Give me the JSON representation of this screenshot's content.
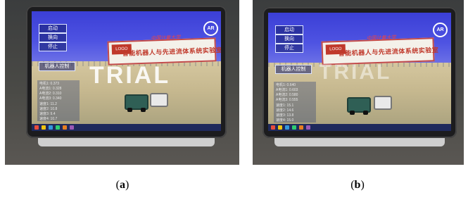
{
  "photo_a": {
    "buttons": [
      "启动",
      "换向",
      "停止"
    ],
    "panel_label": "机器人控制",
    "watermark": "TRIAL",
    "ar_badge": "AR",
    "banner_title": "智能机器人与先进流体系统实验室",
    "banner_script": "中国计量大学",
    "readouts": [
      "电机1: 0.373",
      "A电流1: 0.328",
      "A电流2: 0.310",
      "A电流3: 0.340",
      "速度1: 11.2",
      "速度2: 10.8",
      "速度3: 9.4",
      "速度4: 10.7"
    ],
    "caption_letter": "a"
  },
  "photo_b": {
    "buttons": [
      "启动",
      "换向",
      "停止"
    ],
    "panel_label": "机器人控制",
    "watermark": "TRIAL",
    "ar_badge": "AR",
    "banner_title": "智能机器人与先进流体系统实验室",
    "banner_script": "中国计量大学",
    "readouts": [
      "电机1: 0.640",
      "A电流1: 0.603",
      "A电流2: 0.580",
      "A电流3: 0.555",
      "速度1: 15.1",
      "速度2: 14.6",
      "速度3: 13.8",
      "速度4: 15.0"
    ],
    "caption_letter": "b"
  },
  "colors": {
    "screen_blue": "#3b3fd6",
    "banner_red": "#c0392b",
    "ui_white": "#ffffff"
  }
}
